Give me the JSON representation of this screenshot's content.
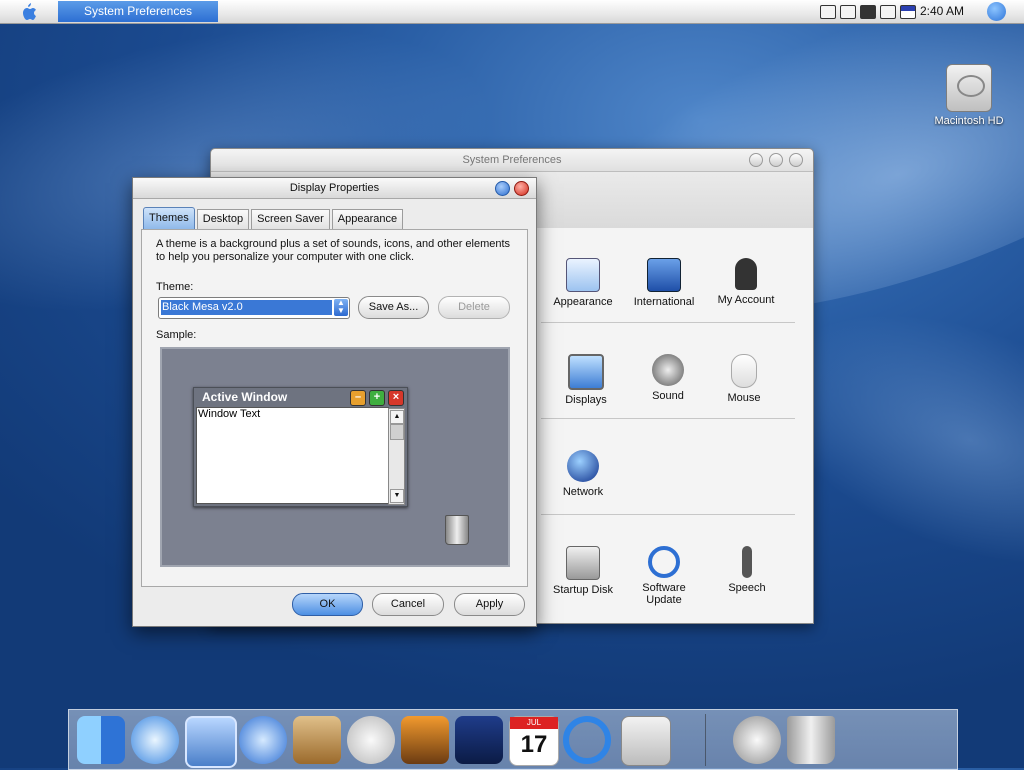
{
  "menubar": {
    "app_name": "System Preferences",
    "clock": "2:40 AM"
  },
  "desktop": {
    "hd_label": "Macintosh HD"
  },
  "sysprefs": {
    "title": "System Preferences",
    "panes_row1": [
      {
        "label": "Appearance",
        "icon": "appearance-icon"
      },
      {
        "label": "International",
        "icon": "international-icon"
      },
      {
        "label": "My Account",
        "icon": "my-account-icon"
      }
    ],
    "panes_row2": [
      {
        "label": "Displays",
        "icon": "displays-icon"
      },
      {
        "label": "Sound",
        "icon": "sound-icon"
      },
      {
        "label": "Mouse",
        "icon": "mouse-icon"
      }
    ],
    "panes_row3": [
      {
        "label": "Network",
        "icon": "network-icon"
      }
    ],
    "panes_row4": [
      {
        "label": "Startup Disk",
        "icon": "startup-disk-icon"
      },
      {
        "label": "Software Update",
        "icon": "software-update-icon"
      },
      {
        "label": "Speech",
        "icon": "speech-icon"
      }
    ]
  },
  "display_properties": {
    "title": "Display Properties",
    "tabs": [
      "Themes",
      "Desktop",
      "Screen Saver",
      "Appearance"
    ],
    "active_tab": "Themes",
    "description": "A theme is a background plus a set of sounds, icons, and other elements to help you personalize your computer with one click.",
    "theme_label": "Theme:",
    "theme_value": "Black Mesa v2.0",
    "save_as": "Save As...",
    "delete": "Delete",
    "sample_label": "Sample:",
    "sample_window_title": "Active Window",
    "sample_window_text": "Window Text",
    "ok": "OK",
    "cancel": "Cancel",
    "apply": "Apply"
  },
  "dock": {
    "items": [
      "finder-icon",
      "safari-icon",
      "mail-icon",
      "ichat-icon",
      "address-book-icon",
      "itunes-icon",
      "iphoto-icon",
      "imovie-icon",
      "ical-icon",
      "quicktime-icon",
      "system-preferences-icon",
      "mail-at-icon",
      "trash-icon"
    ],
    "ical_month": "JUL",
    "ical_day": "17"
  },
  "colors": {
    "accent": "#2d6fd3",
    "desktop_blue": "#1b4a8f",
    "sample_bg": "#7c8190"
  }
}
